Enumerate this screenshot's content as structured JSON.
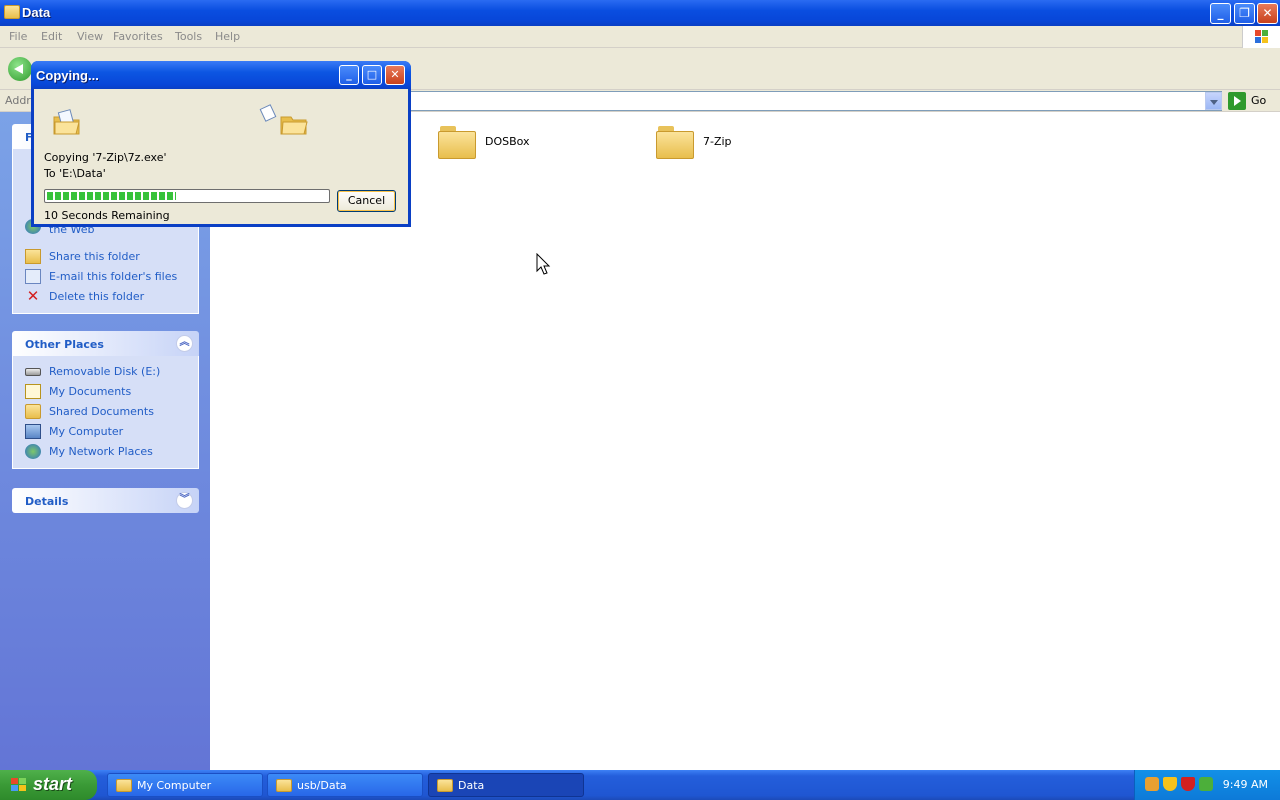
{
  "window": {
    "title": "Data",
    "buttons": {
      "minimize": "_",
      "maximize": "❐",
      "close": "✕"
    }
  },
  "menu": [
    "File",
    "Edit",
    "View",
    "Favorites",
    "Tools",
    "Help"
  ],
  "address": {
    "label": "Addre",
    "value": "",
    "go_label": "Go"
  },
  "left_pane": {
    "file_tasks": {
      "title": "F",
      "items": [
        {
          "label": "Publish this folder to the Web",
          "icon": "globe-icon"
        },
        {
          "label": "Share this folder",
          "icon": "share-folder-icon"
        },
        {
          "label": "E-mail this folder's files",
          "icon": "mail-icon"
        },
        {
          "label": "Delete this folder",
          "icon": "delete-icon"
        }
      ]
    },
    "other_places": {
      "title": "Other Places",
      "items": [
        {
          "label": "Removable Disk (E:)",
          "icon": "drive-icon"
        },
        {
          "label": "My Documents",
          "icon": "documents-icon"
        },
        {
          "label": "Shared Documents",
          "icon": "folder-icon"
        },
        {
          "label": "My Computer",
          "icon": "computer-icon"
        },
        {
          "label": "My Network Places",
          "icon": "network-icon"
        }
      ]
    },
    "details": {
      "title": "Details"
    }
  },
  "content": {
    "items": [
      {
        "name": "DOSBox",
        "icon": "folder-icon"
      },
      {
        "name": "7-Zip",
        "icon": "folder-icon"
      }
    ]
  },
  "dialog": {
    "title": "Copying...",
    "copying_line": "Copying '7-Zip\\7z.exe'",
    "to_line": "To 'E:\\Data'",
    "progress": 0.46,
    "cancel_label": "Cancel",
    "remaining": "10 Seconds Remaining"
  },
  "taskbar": {
    "start_label": "start",
    "tasks": [
      {
        "label": "My Computer",
        "active": false
      },
      {
        "label": "usb/Data",
        "active": false
      },
      {
        "label": "Data",
        "active": true
      }
    ],
    "clock": "9:49 AM"
  },
  "colors": {
    "title_blue": "#0a4ee0",
    "panel_link": "#215dc6",
    "progress_green": "#37c23a",
    "start_green": "#3a9a36"
  }
}
